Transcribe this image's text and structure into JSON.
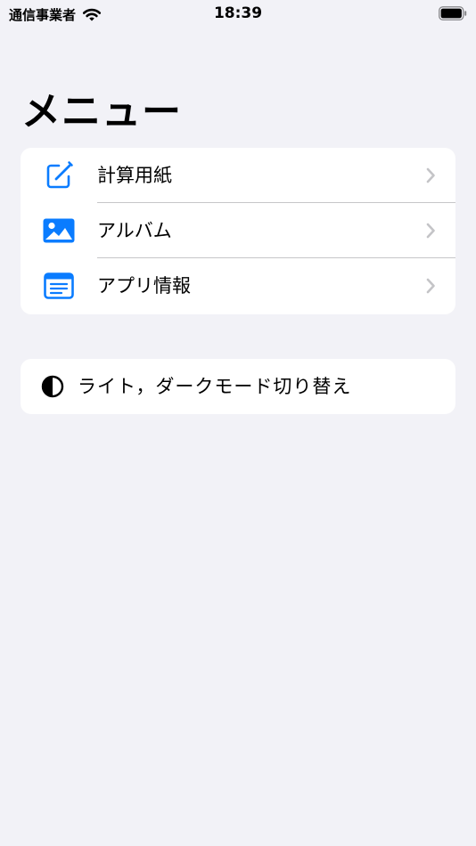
{
  "status_bar": {
    "carrier": "通信事業者",
    "time": "18:39",
    "icons": [
      "wifi-icon",
      "battery-icon"
    ]
  },
  "page": {
    "title": "メニュー"
  },
  "menu": {
    "items": [
      {
        "label": "計算用紙",
        "icon": "pencil-square-icon"
      },
      {
        "label": "アルバム",
        "icon": "photo-icon"
      },
      {
        "label": "アプリ情報",
        "icon": "app-info-icon"
      }
    ]
  },
  "theme": {
    "label": "ライト，ダークモード切り替え",
    "icon": "half-circle-contrast-icon"
  },
  "colors": {
    "background": "#f2f2f7",
    "card": "#ffffff",
    "accent": "#0a7cff",
    "chevron": "#c4c4c7",
    "separator": "#c6c6c8"
  }
}
